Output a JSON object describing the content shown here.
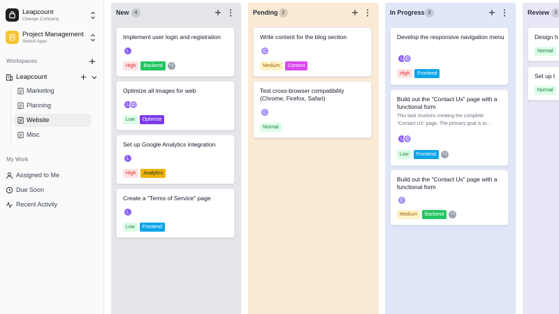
{
  "company": {
    "name": "Leapcount",
    "subtitle": "Change Company"
  },
  "app": {
    "name": "Project Management",
    "subtitle": "Switch Apps"
  },
  "sidebar": {
    "workspaces_label": "Workspaces",
    "workspace": {
      "name": "Leapcount"
    },
    "items": [
      {
        "label": "Marketing"
      },
      {
        "label": "Planning"
      },
      {
        "label": "Website",
        "active": true
      },
      {
        "label": "Misc"
      }
    ],
    "my_work_label": "My Work",
    "my_work": [
      {
        "label": "Assigned to Me",
        "icon": "user-icon"
      },
      {
        "label": "Due Soon",
        "icon": "clock-icon"
      },
      {
        "label": "Recent Activity",
        "icon": "activity-icon"
      }
    ]
  },
  "board": {
    "columns": [
      {
        "title": "New",
        "count": "4",
        "color": "#e4e6ea",
        "cards": [
          {
            "title": "Implement user login and registration",
            "avatars": [
              "L"
            ],
            "tags": [
              "High",
              "Backend"
            ],
            "more": "+1"
          },
          {
            "title": "Optimize all images for web",
            "avatars": [
              "L",
              "C"
            ],
            "tags": [
              "Low",
              "Optimize"
            ]
          },
          {
            "title": "Set up Google Analytics integration",
            "avatars": [
              "L"
            ],
            "tags": [
              "High",
              "Analytics"
            ]
          },
          {
            "title": "Create a \"Terms of Service\" page",
            "avatars": [
              "L"
            ],
            "tags": [
              "Low",
              "Frontend"
            ]
          }
        ]
      },
      {
        "title": "Pending",
        "count": "2",
        "color": "#fbead4",
        "cards": [
          {
            "title": "Write content for the blog section",
            "avatars": [
              "C"
            ],
            "tags": [
              "Medium",
              "Content"
            ]
          },
          {
            "title": "Test cross-browser compatibility (Chrome, Firefox, Safari)",
            "avatars": [
              "C"
            ],
            "tags": [
              "Normal"
            ]
          }
        ]
      },
      {
        "title": "In Progress",
        "count": "3",
        "color": "#dfe7f8",
        "cards": [
          {
            "title": "Develop the responsive navigation menu",
            "avatars": [
              "L",
              "C"
            ],
            "tags": [
              "High",
              "Frontend"
            ]
          },
          {
            "title": "Build out the \"Contact Us\" page with a functional form",
            "description": "This task involves creating the complete \"Contact Us\" page. The primary goal is to...",
            "avatars": [
              "L",
              "C"
            ],
            "tags": [
              "Low",
              "Frontend"
            ],
            "more": "+1"
          },
          {
            "title": "Build out the \"Contact Us\" page with a functional form",
            "avatars": [
              "C"
            ],
            "tags": [
              "Medium",
              "Backend"
            ],
            "more": "+1"
          }
        ]
      },
      {
        "title": "Review",
        "count": "2",
        "color": "#ebe6f7",
        "cards": [
          {
            "title": "Design h",
            "tags": [
              "Normal"
            ]
          },
          {
            "title": "Set up t",
            "tags": [
              "Normal"
            ]
          }
        ]
      }
    ]
  }
}
